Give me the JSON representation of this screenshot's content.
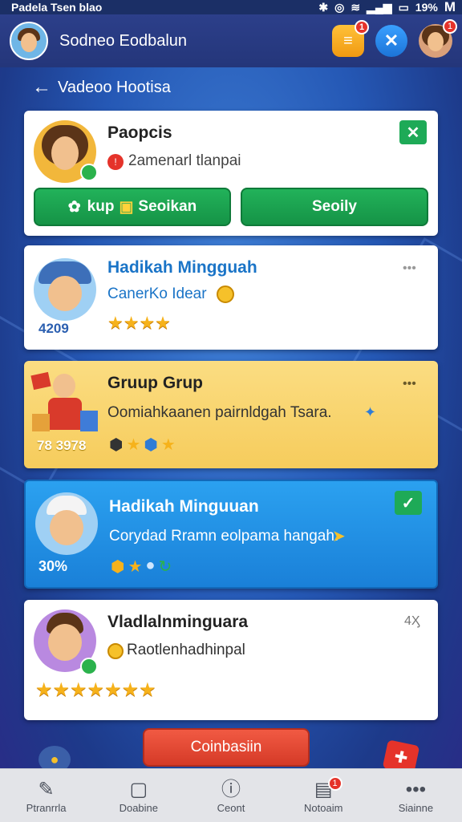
{
  "status": {
    "left_text": "Padela Tsen blao",
    "battery": "19%",
    "carrier": "M"
  },
  "app": {
    "title": "Sodneo Eodbalun",
    "badge_a": "1",
    "badge_b": "1"
  },
  "subheader": {
    "label": "Vadeoo Hootisa"
  },
  "cards": [
    {
      "title": "Paopcis",
      "subtitle": "2amenarl tlanpai",
      "button_left": "kup",
      "button_left_extra": "Seoikan",
      "button_right": "Seoily",
      "check": "✕"
    },
    {
      "title": "Hadikah Mingguah",
      "subtitle": "CanerKo Idear",
      "count": "4209",
      "stars": "★★★★",
      "menu": "•••"
    },
    {
      "title": "Gruup Grup",
      "subtitle": "Oomiahkaanen pairnldgah Tsara.",
      "count": "78 3978",
      "menu": "•••"
    },
    {
      "title": "Hadikah Minguuan",
      "subtitle": "Corydad Rramn eolpama hangah.",
      "count": "30%",
      "check": "✓"
    },
    {
      "title": "Vladlalnminguara",
      "subtitle": "Raotlenhadhinpal",
      "corner": "4Ӽ",
      "stars": "★★★★★★★"
    }
  ],
  "action_button": "Coinbasiin",
  "tabs": [
    {
      "label": "Ptranrrla",
      "icon": "edit-icon"
    },
    {
      "label": "Doabine",
      "icon": "square-icon"
    },
    {
      "label": "Ceont",
      "icon": "info-icon"
    },
    {
      "label": "Notoaim",
      "icon": "notes-icon",
      "badge": "1"
    },
    {
      "label": "Siainne",
      "icon": "more-icon"
    }
  ],
  "colors": {
    "accent_green": "#1eaa57",
    "accent_blue": "#1d8fe0",
    "accent_yellow": "#f8d36a",
    "accent_red": "#e5332a"
  }
}
